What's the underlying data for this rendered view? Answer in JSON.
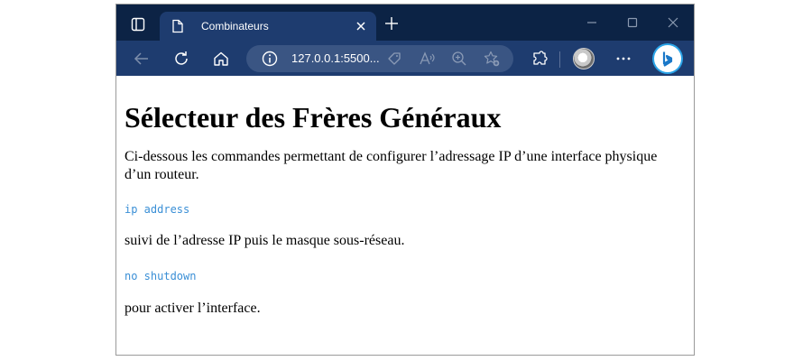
{
  "browser": {
    "tab_title": "Combinateurs",
    "url": "127.0.0.1:5500...",
    "accent_color": "#0c2345",
    "toolbar_color": "#1e3c6f"
  },
  "page": {
    "heading": "Sélecteur des Frères Généraux",
    "intro": "Ci-dessous les commandes permettant de configurer l’adressage IP d’une interface physique d’un routeur.",
    "command_1": "ip address",
    "text_1": "suivi de l’adresse IP puis le masque sous-réseau.",
    "command_2": "no shutdown",
    "text_2": "pour activer l’interface.",
    "code_color": "#3a8fd6"
  }
}
